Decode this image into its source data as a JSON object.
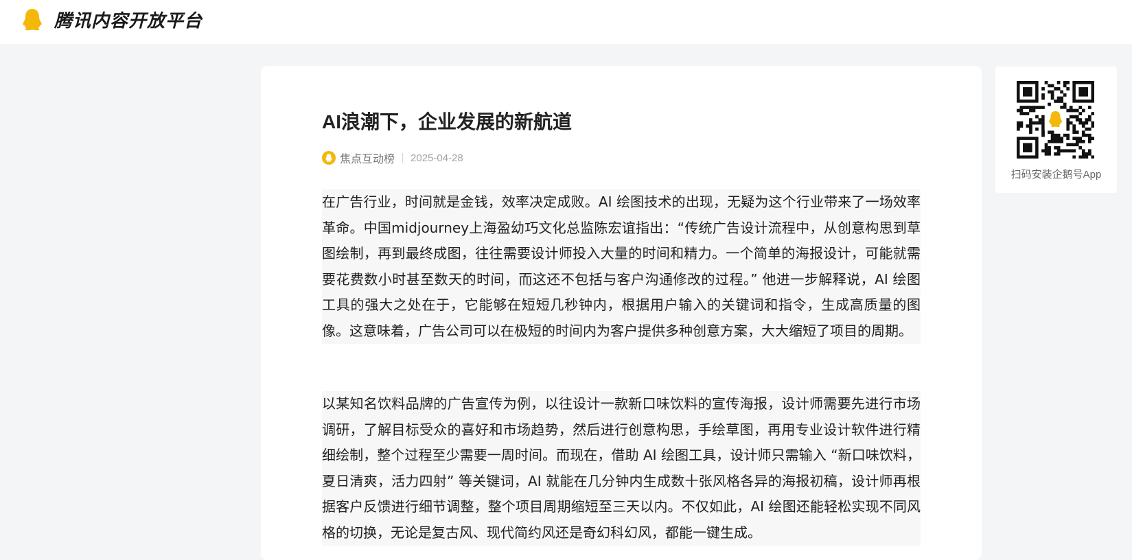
{
  "header": {
    "logo_text": "腾讯内容开放平台",
    "logo_icon": "penguin-icon"
  },
  "article": {
    "title": "AI浪潮下，企业发展的新航道",
    "author": "焦点互动榜",
    "date": "2025-04-28",
    "paragraphs": [
      "在广告行业，时间就是金钱，效率决定成败。AI 绘图技术的出现，无疑为这个行业带来了一场效率革命。中国midjourney上海盈幼巧文化总监陈宏谊指出：“传统广告设计流程中，从创意构思到草图绘制，再到最终成图，往往需要设计师投入大量的时间和精力。一个简单的海报设计，可能就需要花费数小时甚至数天的时间，而这还不包括与客户沟通修改的过程。” 他进一步解释说，AI 绘图工具的强大之处在于，它能够在短短几秒钟内，根据用户输入的关键词和指令，生成高质量的图像。这意味着，广告公司可以在极短的时间内为客户提供多种创意方案，大大缩短了项目的周期。",
      "以某知名饮料品牌的广告宣传为例，以往设计一款新口味饮料的宣传海报，设计师需要先进行市场调研，了解目标受众的喜好和市场趋势，然后进行创意构思，手绘草图，再用专业设计软件进行精细绘制，整个过程至少需要一周时间。而现在，借助 AI 绘图工具，设计师只需输入 “新口味饮料，夏日清爽，活力四射” 等关键词，AI 就能在几分钟内生成数十张风格各异的海报初稿，设计师再根据客户反馈进行细节调整，整个项目周期缩短至三天以内。不仅如此，AI 绘图还能轻松实现不同风格的切换，无论是复古风、现代简约风还是奇幻科幻风，都能一键生成。"
    ]
  },
  "sidebar": {
    "qr_caption": "扫码安装企鹅号App",
    "qr_icon": "qr-code-icon"
  },
  "colors": {
    "brand_yellow": "#f5b70a",
    "page_bg": "#f4f5f7",
    "paragraph_bg": "#f7f7f7"
  }
}
